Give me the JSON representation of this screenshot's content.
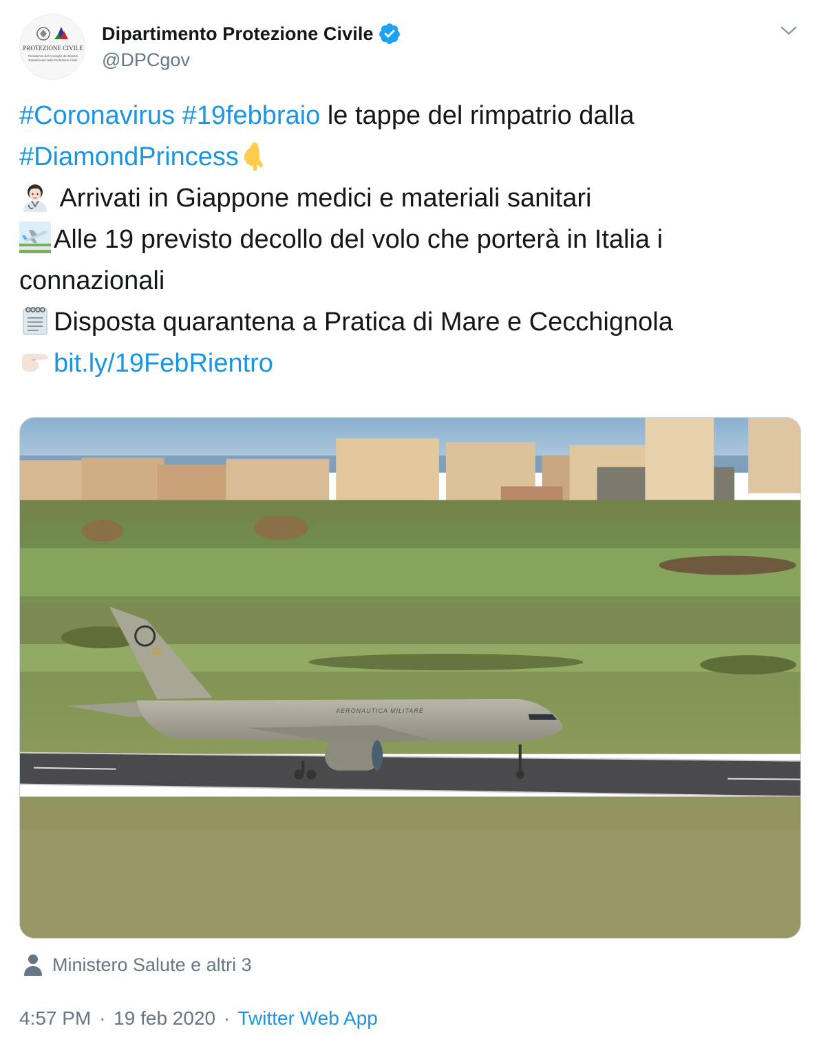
{
  "user": {
    "display_name": "Dipartimento Protezione Civile",
    "handle": "@DPCgov",
    "avatar_caption": "PROTEZIONE CIVILE",
    "avatar_sub1": "Presidenza del Consiglio dei Ministri",
    "avatar_sub2": "Dipartimento della Protezione Civile"
  },
  "tweet": {
    "line1": {
      "hashtag1": "#Coronavirus",
      "hashtag2": "#19febbraio",
      "text": " le tappe del rimpatrio dalla"
    },
    "line2": {
      "hashtag": "#DiamondPrincess",
      "emoji": "backhand-index-pointing-down-emoji"
    },
    "line3": {
      "emoji": "woman-health-worker-emoji",
      "text": " Arrivati in Giappone medici e materiali sanitari"
    },
    "line4": {
      "emoji": "airplane-departure-emoji",
      "text": "Alle 19 previsto decollo del volo che porterà in Italia i"
    },
    "line5": {
      "text": "connazionali"
    },
    "line6": {
      "emoji": "spiral-notepad-emoji",
      "text": "Disposta quarantena a Pratica di Mare e Cecchignola"
    },
    "line7": {
      "emoji": "backhand-index-pointing-right-emoji",
      "link": "bit.ly/19FebRientro"
    }
  },
  "media": {
    "fuselage_text": "AERONAUTICA MILITARE"
  },
  "tagged": {
    "icon": "person-icon",
    "text": "Ministero Salute e altri 3"
  },
  "meta": {
    "time": "4:57 PM",
    "date": "19 feb 2020",
    "separator": "·",
    "source": "Twitter Web App"
  },
  "colors": {
    "link_blue": "#1b95e0",
    "verified_blue": "#1da1f2",
    "secondary_text": "#657786",
    "primary_text": "#14171a"
  }
}
